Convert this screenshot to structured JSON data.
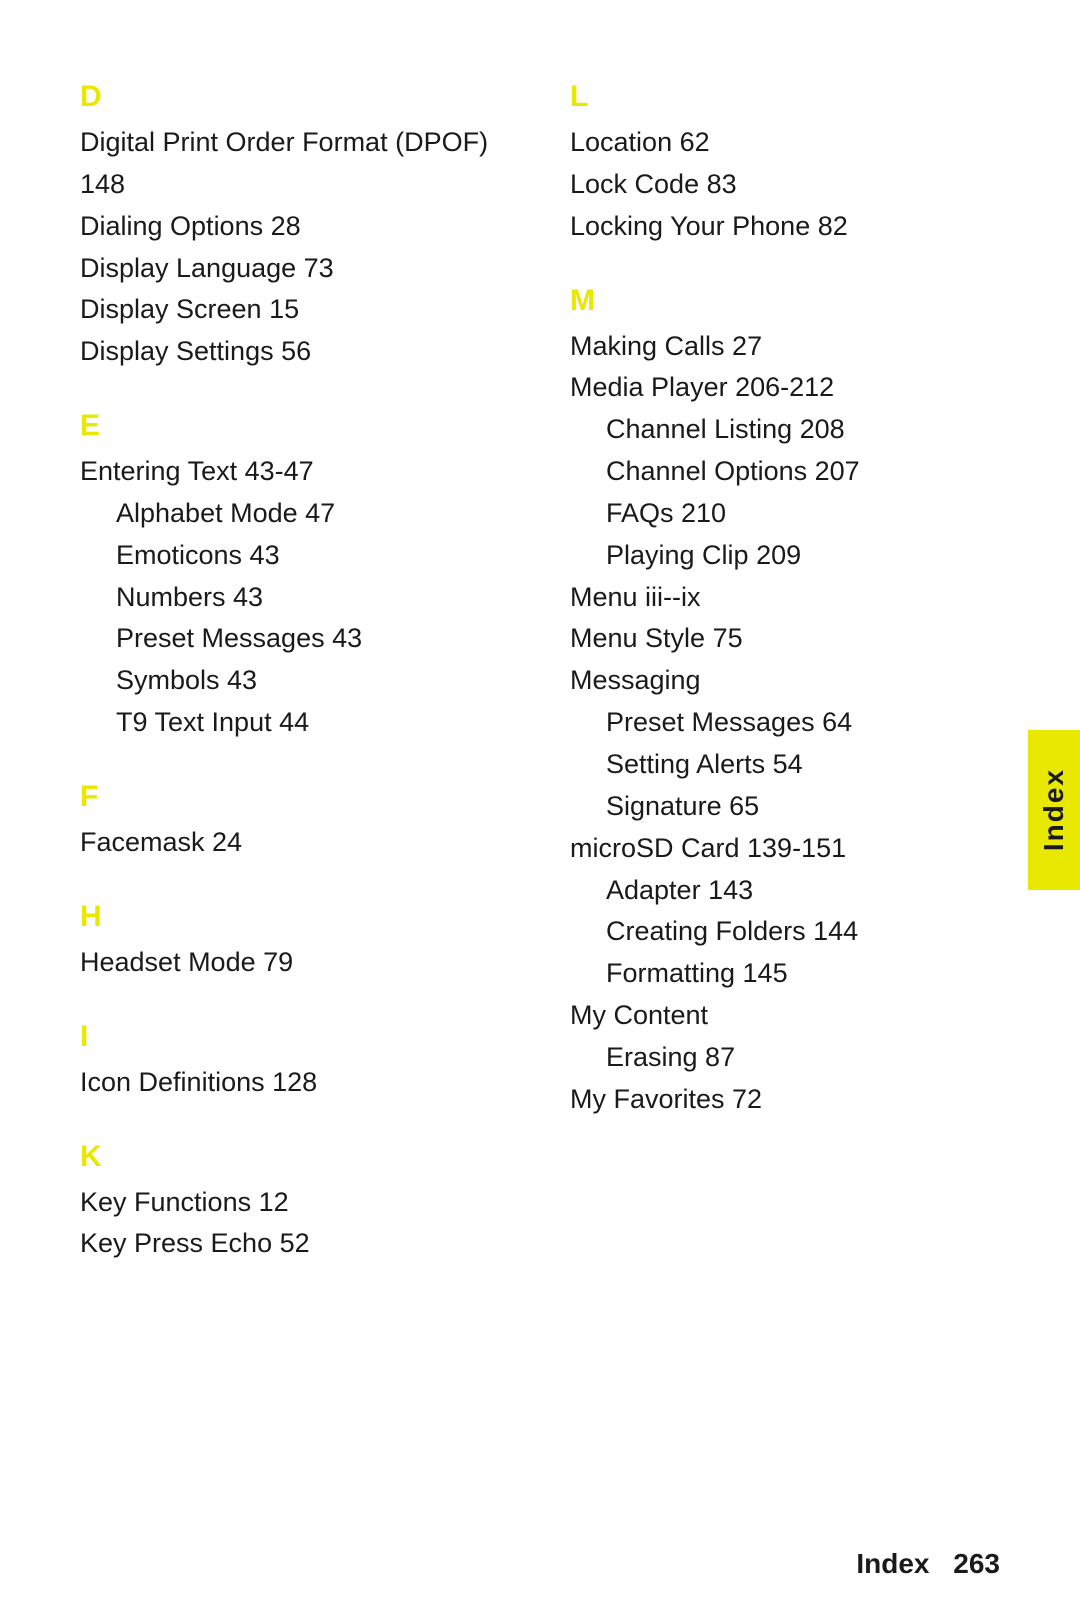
{
  "left_column": {
    "sections": [
      {
        "letter": "D",
        "entries": [
          {
            "text": "Digital Print Order Format (DPOF) 148",
            "indented": false
          },
          {
            "text": "Dialing Options 28",
            "indented": false
          },
          {
            "text": "Display Language 73",
            "indented": false
          },
          {
            "text": "Display Screen 15",
            "indented": false
          },
          {
            "text": "Display Settings 56",
            "indented": false
          }
        ]
      },
      {
        "letter": "E",
        "entries": [
          {
            "text": "Entering Text 43-47",
            "indented": false
          },
          {
            "text": "Alphabet Mode 47",
            "indented": true
          },
          {
            "text": "Emoticons 43",
            "indented": true
          },
          {
            "text": "Numbers 43",
            "indented": true
          },
          {
            "text": "Preset Messages 43",
            "indented": true
          },
          {
            "text": "Symbols 43",
            "indented": true
          },
          {
            "text": "T9 Text Input 44",
            "indented": true
          }
        ]
      },
      {
        "letter": "F",
        "entries": [
          {
            "text": "Facemask 24",
            "indented": false
          }
        ]
      },
      {
        "letter": "H",
        "entries": [
          {
            "text": "Headset Mode 79",
            "indented": false
          }
        ]
      },
      {
        "letter": "I",
        "entries": [
          {
            "text": "Icon Definitions 128",
            "indented": false
          }
        ]
      },
      {
        "letter": "K",
        "entries": [
          {
            "text": "Key Functions 12",
            "indented": false
          },
          {
            "text": "Key Press Echo 52",
            "indented": false
          }
        ]
      }
    ]
  },
  "right_column": {
    "sections": [
      {
        "letter": "L",
        "entries": [
          {
            "text": "Location 62",
            "indented": false
          },
          {
            "text": "Lock Code 83",
            "indented": false
          },
          {
            "text": "Locking Your Phone 82",
            "indented": false
          }
        ]
      },
      {
        "letter": "M",
        "entries": [
          {
            "text": "Making Calls 27",
            "indented": false
          },
          {
            "text": "Media Player 206-212",
            "indented": false
          },
          {
            "text": "Channel Listing 208",
            "indented": true
          },
          {
            "text": "Channel Options 207",
            "indented": true
          },
          {
            "text": "FAQs 210",
            "indented": true
          },
          {
            "text": "Playing Clip 209",
            "indented": true
          },
          {
            "text": "Menu iii--ix",
            "indented": false
          },
          {
            "text": "Menu Style 75",
            "indented": false
          },
          {
            "text": "Messaging",
            "indented": false
          },
          {
            "text": "Preset Messages 64",
            "indented": true
          },
          {
            "text": "Setting Alerts 54",
            "indented": true
          },
          {
            "text": "Signature 65",
            "indented": true
          },
          {
            "text": "microSD Card 139-151",
            "indented": false
          },
          {
            "text": "Adapter 143",
            "indented": true
          },
          {
            "text": "Creating Folders 144",
            "indented": true
          },
          {
            "text": "Formatting 145",
            "indented": true
          },
          {
            "text": "My Content",
            "indented": false
          },
          {
            "text": "Erasing 87",
            "indented": true
          },
          {
            "text": "My Favorites 72",
            "indented": false
          }
        ]
      }
    ]
  },
  "side_tab": {
    "label": "Index"
  },
  "footer": {
    "label": "Index",
    "page": "263"
  }
}
